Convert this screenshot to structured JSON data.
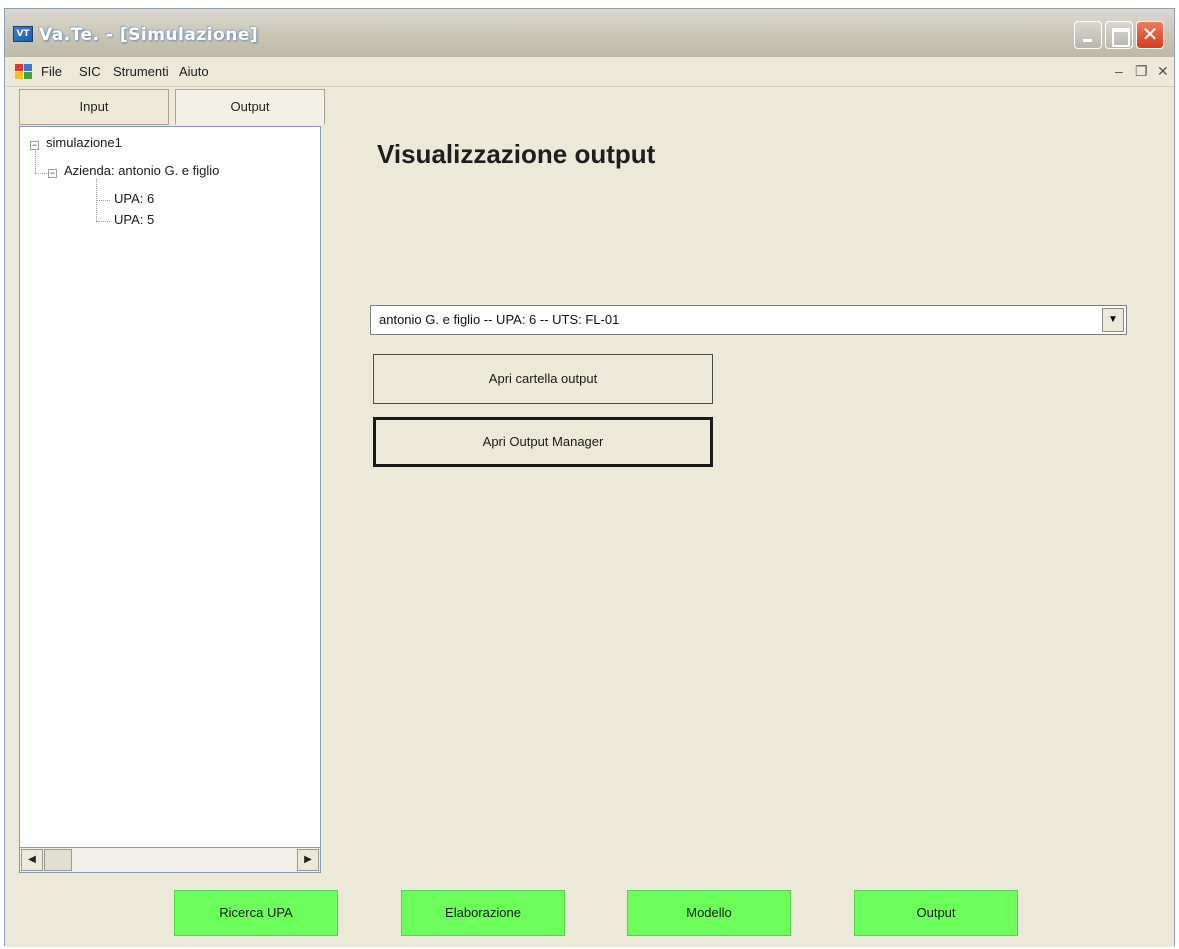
{
  "window": {
    "title": "Va.Te. - [Simulazione]"
  },
  "menubar": {
    "items": [
      "File",
      "SIC",
      "Strumenti",
      "Aiuto"
    ]
  },
  "tabs": [
    {
      "label": "Input",
      "active": false
    },
    {
      "label": "Output",
      "active": true
    }
  ],
  "tree": {
    "root": "simulazione1",
    "child": "Azienda: antonio G. e figlio",
    "leaves": [
      "UPA: 6",
      "UPA: 5"
    ]
  },
  "main": {
    "heading": "Visualizzazione output",
    "combo_value": "antonio G. e figlio -- UPA: 6 -- UTS: FL-01",
    "btn_open_folder": "Apri cartella output",
    "btn_output_manager": "Apri Output Manager"
  },
  "bottom_nav": [
    "Ricerca UPA",
    "Elaborazione",
    "Modello",
    "Output"
  ],
  "colors": {
    "nav_green": "#6cff5c",
    "window_face": "#ece9d8",
    "close_red": "#d33e1b"
  }
}
